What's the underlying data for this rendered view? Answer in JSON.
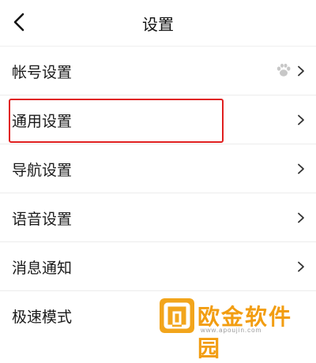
{
  "header": {
    "title": "设置",
    "back_icon": "back-arrow-icon"
  },
  "settings": {
    "items": [
      {
        "label": "帐号设置",
        "icon": "paw-icon"
      },
      {
        "label": "通用设置"
      },
      {
        "label": "导航设置"
      },
      {
        "label": "语音设置"
      },
      {
        "label": "消息通知"
      },
      {
        "label": "极速模式"
      }
    ]
  },
  "annotation": {
    "highlight_color": "#e02020"
  },
  "watermark": {
    "brand": "欧金软件园",
    "url": "www.apoujin.com",
    "color": "#f29d11"
  }
}
